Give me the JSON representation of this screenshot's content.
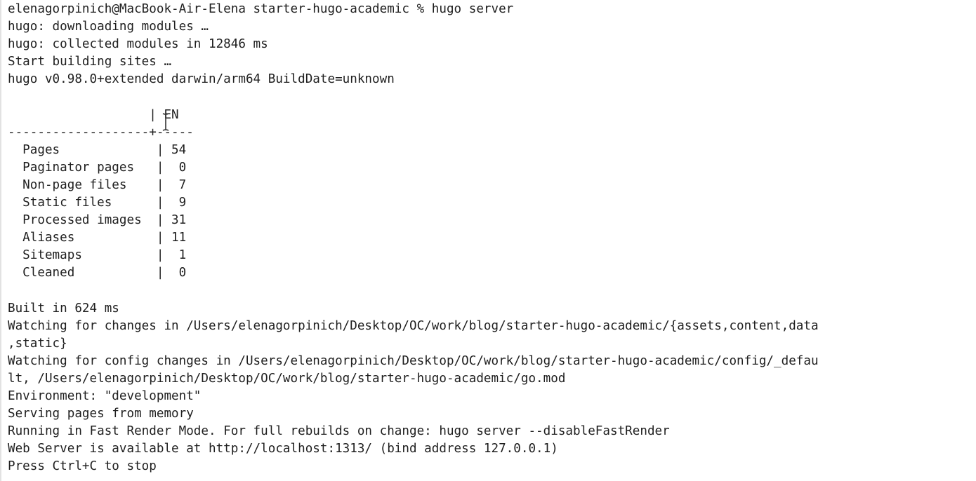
{
  "terminal": {
    "prompt": "elenagorpinich@MacBook-Air-Elena starter-hugo-academic % hugo server",
    "intro": [
      "hugo: downloading modules …",
      "hugo: collected modules in 12846 ms",
      "Start building sites …",
      "hugo v0.98.0+extended darwin/arm64 BuildDate=unknown"
    ],
    "table": {
      "header": "                   | EN",
      "separator": "-------------------+-----",
      "rows": [
        "  Pages             | 54",
        "  Paginator pages   |  0",
        "  Non-page files    |  7",
        "  Static files      |  9",
        "  Processed images  | 31",
        "  Aliases           | 11",
        "  Sitemaps          |  1",
        "  Cleaned           |  0"
      ]
    },
    "output": [
      "Built in 624 ms",
      "Watching for changes in /Users/elenagorpinich/Desktop/OC/work/blog/starter-hugo-academic/{assets,content,data",
      ",static}",
      "Watching for config changes in /Users/elenagorpinich/Desktop/OC/work/blog/starter-hugo-academic/config/_defau",
      "lt, /Users/elenagorpinich/Desktop/OC/work/blog/starter-hugo-academic/go.mod",
      "Environment: \"development\"",
      "Serving pages from memory",
      "Running in Fast Render Mode. For full rebuilds on change: hugo server --disableFastRender",
      "Web Server is available at http://localhost:1313/ (bind address 127.0.0.1)",
      "Press Ctrl+C to stop"
    ],
    "mouse_pointer": "text-cursor-icon",
    "terminal_cursor": "block-cursor-icon"
  }
}
